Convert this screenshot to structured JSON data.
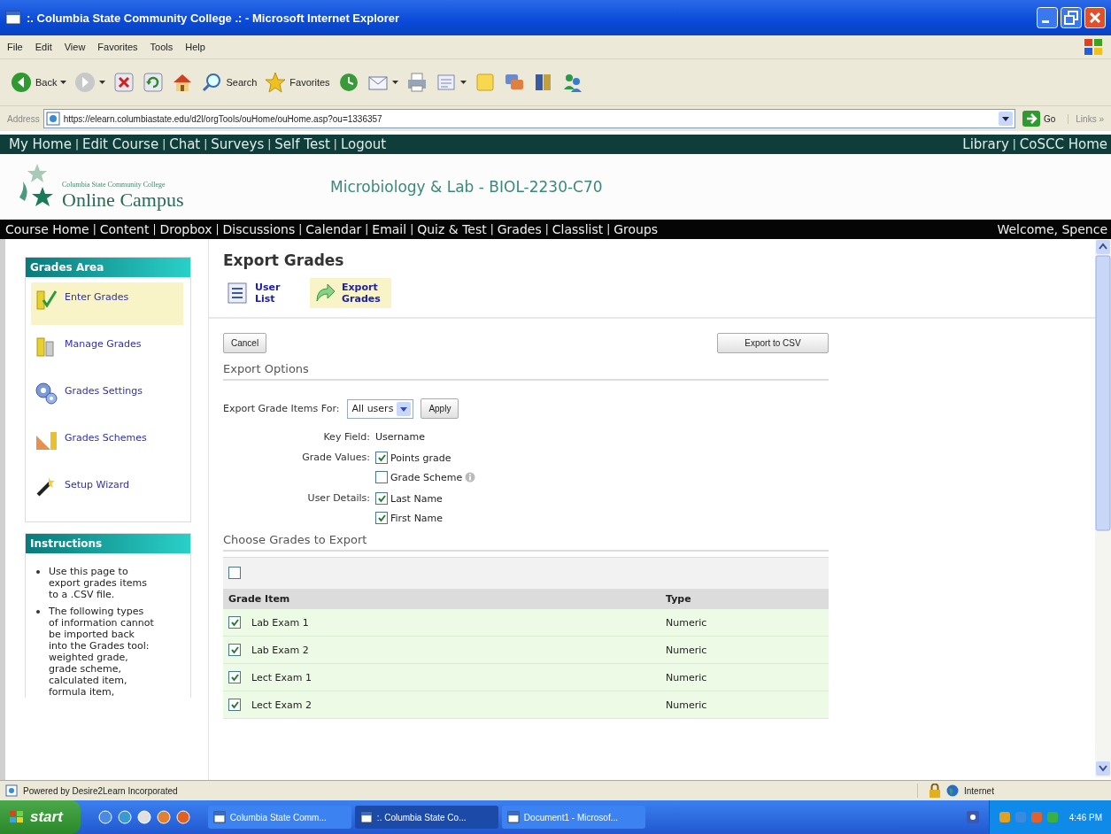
{
  "window": {
    "title": ":. Columbia State Community College .: - Microsoft Internet Explorer"
  },
  "menu": [
    "File",
    "Edit",
    "View",
    "Favorites",
    "Tools",
    "Help"
  ],
  "toolbar": [
    {
      "kind": "back",
      "label": "Back",
      "dropdown": true
    },
    {
      "kind": "forward",
      "dropdown": true
    },
    {
      "kind": "stop"
    },
    {
      "kind": "refresh"
    },
    {
      "kind": "home"
    },
    {
      "kind": "search",
      "label": "Search"
    },
    {
      "kind": "favorites",
      "label": "Favorites"
    },
    {
      "kind": "history"
    },
    {
      "kind": "mail",
      "dropdown": true
    },
    {
      "kind": "print"
    },
    {
      "kind": "edit",
      "dropdown": true
    },
    {
      "kind": "note"
    },
    {
      "kind": "discuss"
    },
    {
      "kind": "research"
    },
    {
      "kind": "messenger"
    }
  ],
  "address": {
    "label": "Address",
    "url": "https://elearn.columbiastate.edu/d2l/orgTools/ouHome/ouHome.asp?ou=1336357",
    "go": "Go",
    "links": "Links »"
  },
  "top_nav": {
    "separator": "|",
    "left": [
      "My Home",
      "Edit Course",
      "Chat",
      "Surveys",
      "Self Test",
      "Logout"
    ],
    "right": [
      "Library",
      "CoSCC Home"
    ]
  },
  "logo": {
    "college": "Columbia State Community College",
    "name": "Online Campus"
  },
  "course_title": "Microbiology & Lab - BIOL-2230-C70",
  "course_nav": {
    "separator": "|",
    "items": [
      "Course Home",
      "Content",
      "Dropbox",
      "Discussions",
      "Calendar",
      "Email",
      "Quiz & Test",
      "Grades",
      "Classlist",
      "Groups"
    ],
    "welcome": "Welcome, Spence"
  },
  "sidebar": {
    "title": "Grades Area",
    "items": [
      {
        "kind": "enter",
        "label": "Enter Grades",
        "selected": true
      },
      {
        "kind": "manage",
        "label": "Manage Grades",
        "selected": false
      },
      {
        "kind": "settings",
        "label": "Grades Settings",
        "selected": false
      },
      {
        "kind": "schemes",
        "label": "Grades Schemes",
        "selected": false
      },
      {
        "kind": "wizard",
        "label": "Setup Wizard",
        "selected": false
      }
    ],
    "instructions_title": "Instructions",
    "instructions": [
      "Use this page to export grades items to a .CSV file.",
      "The following types of information cannot be imported back into the Grades tool: weighted grade, grade scheme, calculated item, formula item,"
    ]
  },
  "main": {
    "heading": "Export Grades",
    "tabs": [
      {
        "kind": "list",
        "label": "User List",
        "selected": false
      },
      {
        "kind": "export",
        "label": "Export Grades",
        "selected": true
      }
    ],
    "cancel": "Cancel",
    "export": "Export to CSV",
    "options_title": "Export Options",
    "export_for": {
      "label": "Export Grade Items For:",
      "value": "All users",
      "apply": "Apply"
    },
    "key_field": {
      "label": "Key Field:",
      "value": "Username"
    },
    "groups": [
      {
        "label": "Grade Values:",
        "options": [
          {
            "label": "Points grade",
            "checked": true,
            "info": false
          },
          {
            "label": "Grade Scheme",
            "checked": false,
            "info": true
          }
        ]
      },
      {
        "label": "User Details:",
        "options": [
          {
            "label": "Last Name",
            "checked": true,
            "info": false
          },
          {
            "label": "First Name",
            "checked": true,
            "info": false
          }
        ]
      }
    ],
    "choose_title": "Choose Grades to Export",
    "select_all": {
      "checked": false
    },
    "columns": [
      "Grade Item",
      "Type"
    ],
    "rows": [
      {
        "name": "Lab Exam 1",
        "type": "Numeric",
        "checked": true
      },
      {
        "name": "Lab Exam 2",
        "type": "Numeric",
        "checked": true
      },
      {
        "name": "Lect Exam 1",
        "type": "Numeric",
        "checked": true
      },
      {
        "name": "Lect Exam 2",
        "type": "Numeric",
        "checked": true
      }
    ]
  },
  "status_bar": {
    "text": "Powered by Desire2Learn Incorporated",
    "zone": "Internet"
  },
  "taskbar": {
    "start": "start",
    "tasks": [
      {
        "label": "Columbia State Comm...",
        "selected": false
      },
      {
        "label": ":. Columbia State Co...",
        "selected": true
      },
      {
        "label": "Document1 - Microsof...",
        "selected": false
      }
    ],
    "time": "4:46 PM"
  }
}
